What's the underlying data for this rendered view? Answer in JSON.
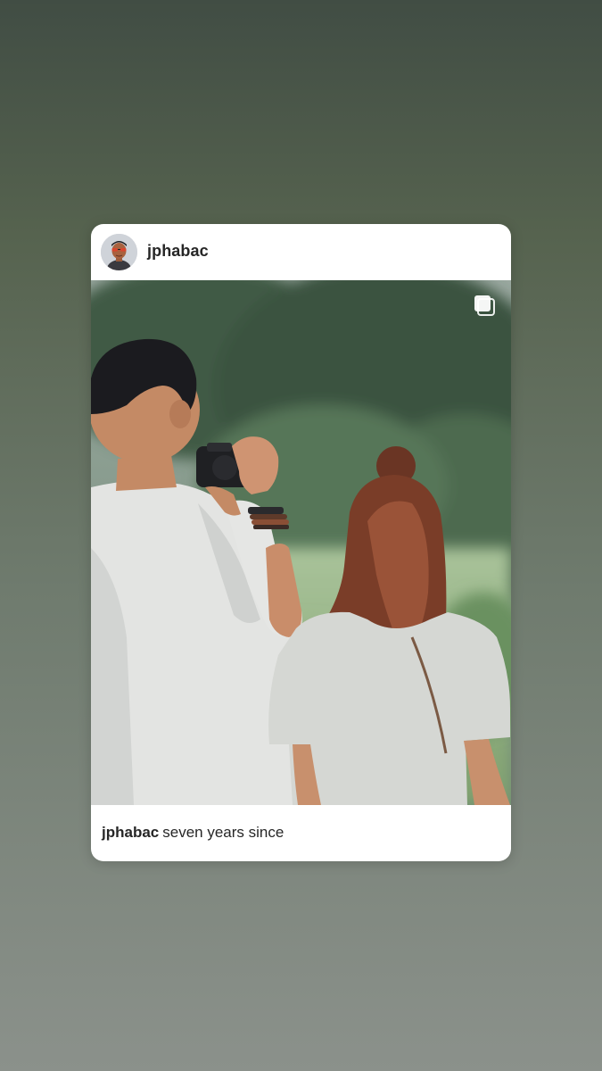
{
  "post": {
    "username": "jphabac",
    "caption_username": "jphabac",
    "caption_text": "seven years since",
    "media_icon": "multiple-photos-icon"
  },
  "colors": {
    "background_top": "#414d44",
    "background_bottom": "#8b918b",
    "card": "#ffffff",
    "text": "#262626"
  }
}
